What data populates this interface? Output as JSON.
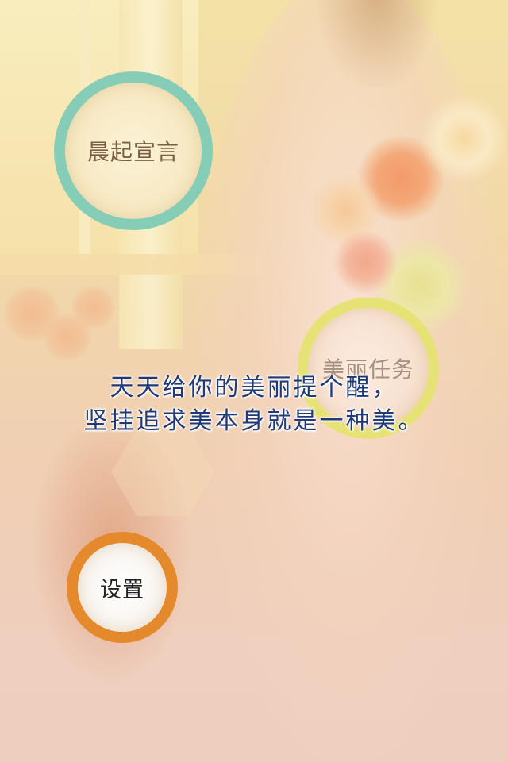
{
  "menu": {
    "morning_declaration": "晨起宣言",
    "beauty_task": "美丽任务",
    "settings": "设置"
  },
  "slogan": {
    "line1": "天天给你的美丽提个醒，",
    "line2": "坚挂追求美本身就是一种美。"
  },
  "colors": {
    "morning_ring": "#86cdb7",
    "task_ring": "#e7e275",
    "settings_ring": "#e58a2c",
    "slogan_text": "#1f3a78"
  }
}
